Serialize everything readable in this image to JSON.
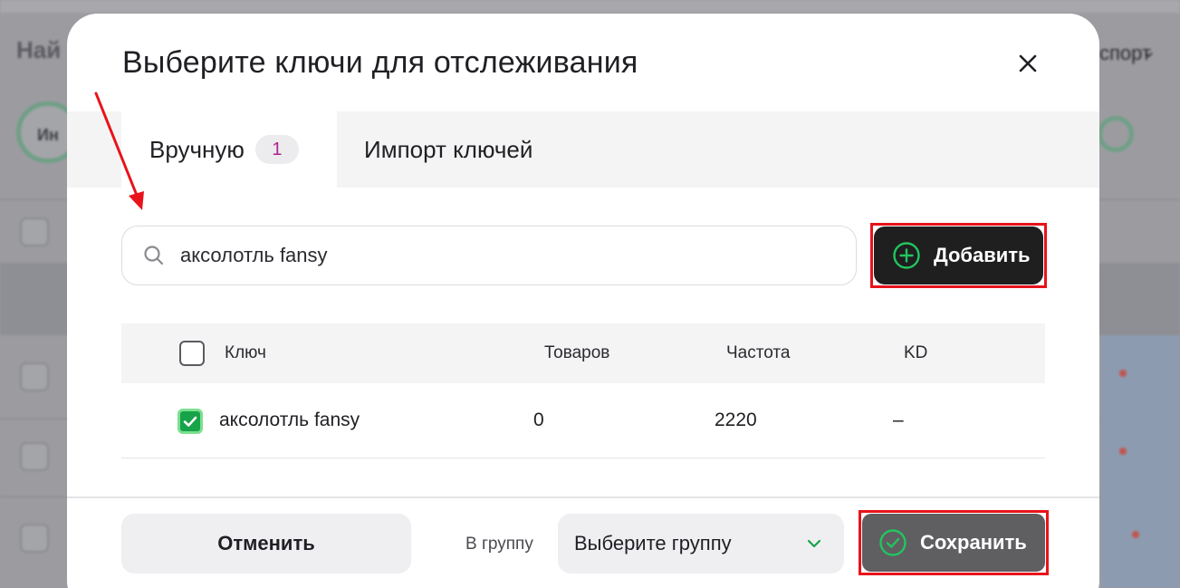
{
  "background": {
    "export_label": "спорт"
  },
  "modal": {
    "title": "Выберите ключи для отслеживания",
    "tabs": [
      {
        "label": "Вручную",
        "badge": "1",
        "active": true
      },
      {
        "label": "Импорт ключей",
        "active": false
      }
    ],
    "search": {
      "value": "аксолотль fansy",
      "icon": "search-icon"
    },
    "add_button": {
      "label": "Добавить",
      "icon": "plus-circle-icon"
    },
    "table": {
      "columns": [
        "Ключ",
        "Товаров",
        "Частота",
        "KD"
      ],
      "rows": [
        {
          "checked": true,
          "key": "аксолотль fansy",
          "products": "0",
          "frequency": "2220",
          "kd": "–"
        }
      ]
    },
    "footer": {
      "cancel_label": "Отменить",
      "group_label": "В группу",
      "group_select_value": "Выберите группу",
      "save_label": "Сохранить"
    }
  },
  "colors": {
    "accent_green": "#16a34a",
    "highlight_red": "#e8131b",
    "badge_magenta": "#b0228d"
  }
}
